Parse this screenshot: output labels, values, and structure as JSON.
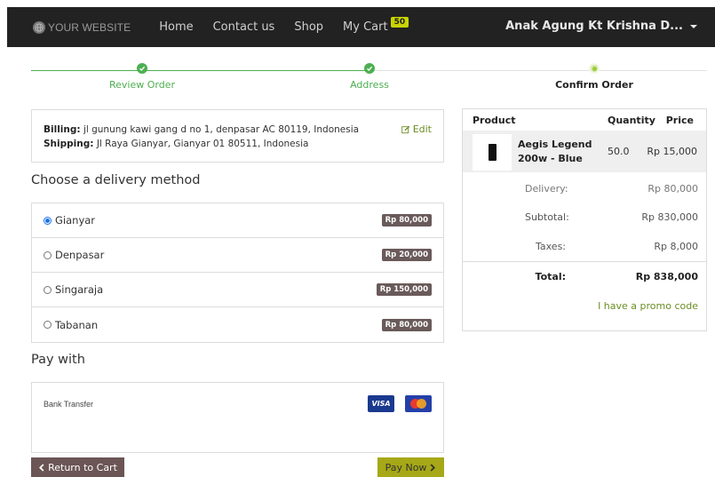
{
  "navbar": {
    "brand": "YOUR WEBSITE",
    "links": [
      "Home",
      "Contact us",
      "Shop"
    ],
    "cart_label": "My Cart",
    "cart_count": "50",
    "user": "Anak Agung Kt Krishna D..."
  },
  "steps": [
    {
      "label": "Review Order",
      "state": "done"
    },
    {
      "label": "Address",
      "state": "done"
    },
    {
      "label": "Confirm Order",
      "state": "current"
    }
  ],
  "address": {
    "billing_label": "Billing:",
    "billing_value": "jl gunung kawi gang d no 1, denpasar AC 80119, Indonesia",
    "shipping_label": "Shipping:",
    "shipping_value": "Jl Raya Gianyar, Gianyar 01 80511, Indonesia",
    "edit_label": "Edit"
  },
  "delivery": {
    "title": "Choose a delivery method",
    "options": [
      {
        "name": "Gianyar",
        "price": "Rp 80,000",
        "selected": true
      },
      {
        "name": "Denpasar",
        "price": "Rp 20,000",
        "selected": false
      },
      {
        "name": "Singaraja",
        "price": "Rp 150,000",
        "selected": false
      },
      {
        "name": "Tabanan",
        "price": "Rp 80,000",
        "selected": false
      }
    ]
  },
  "payment": {
    "title": "Pay with",
    "method": "Bank Transfer",
    "visa_label": "VISA"
  },
  "buttons": {
    "return": "Return to Cart",
    "pay": "Pay Now"
  },
  "summary": {
    "headers": {
      "product": "Product",
      "quantity": "Quantity",
      "price": "Price"
    },
    "item": {
      "name_line1": "Aegis Legend",
      "name_line2": "200w - Blue",
      "quantity": "50.0",
      "price": "Rp 15,000"
    },
    "delivery_label": "Delivery:",
    "delivery_value": "Rp 80,000",
    "subtotal_label": "Subtotal:",
    "subtotal_value": "Rp 830,000",
    "taxes_label": "Taxes:",
    "taxes_value": "Rp 8,000",
    "total_label": "Total:",
    "total_value": "Rp 838,000",
    "promo": "I have a promo code"
  },
  "colors": {
    "navbar": "#222222",
    "success": "#4caf50",
    "accent_link": "#6b8e23",
    "price_badge": "#6a5a5a",
    "pay_button": "#a6a817",
    "return_button": "#6b5555"
  }
}
